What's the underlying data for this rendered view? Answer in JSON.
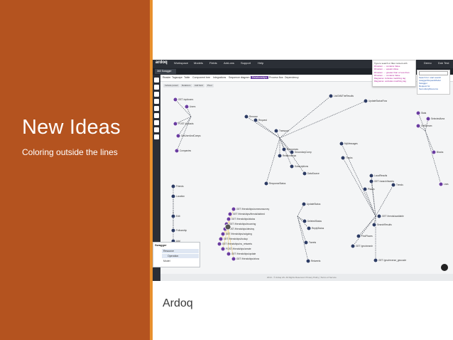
{
  "slide": {
    "title": "New Ideas",
    "subtitle": "Coloring outside the lines",
    "caption": "Ardoq"
  },
  "app": {
    "logo": "ardoq",
    "nav": [
      "Workspace",
      "Models",
      "Fields",
      "Add-ons",
      "Support",
      "Help"
    ],
    "right_menu": [
      "Demo",
      "Dok Test"
    ],
    "tab": "360 Swagger"
  },
  "views": {
    "items": [
      "Reader",
      "Tagscape",
      "Table",
      "Component tree",
      "Integrations",
      "Sequence diagram",
      "Relationships",
      "Process flow",
      "Dependency"
    ],
    "active": "Relationships"
  },
  "actions": [
    "Include parent",
    "Relations",
    "Add field",
    "Pivot"
  ],
  "tooltip": {
    "head": "Type to search or filter content with",
    "lines": [
      "#Custom ...: contains Value",
      "#Custom ...: equals Value",
      "#Custom ...: greater than or less than",
      "#Custom ...: contains Value",
      "#tagname: includes matching tag",
      "#tagname: excludes matching tag"
    ]
  },
  "search_results": [
    "Search for: start search",
    "swaggerRequestModel",
    "Swagger",
    "Request for",
    "SecondaryResource"
  ],
  "swagger_panel": {
    "title": "Swagger",
    "rows": [
      "Resource",
      "Operation",
      "Model"
    ]
  },
  "footer": "2014 - © Ardoq AS. All Rights Reserved. Privacy Policy | Terms of Service",
  "graph_labels": {
    "top_left": [
      "GET /api/users",
      "Users",
      "POST /uploads",
      "GetUserAndComps",
      "Companies"
    ],
    "top_mid": [
      "ListOfAllTheResults",
      "UpdateStatusFlow",
      "Remove",
      "Request",
      "Transport",
      "Responses",
      "SecondaryComp",
      "Relationships",
      "Subscriptions",
      "DataSource",
      "ResponseStatus"
    ],
    "left_edge": [
      "Friends",
      "Location",
      "Edit",
      "Followship",
      "Add"
    ],
    "cluster": [
      "GET /friendships/commonsurvey",
      "GET /friendships/friends/tabbed",
      "GET /friendships/status",
      "GET /friendships/incoming",
      "POST /friendships/destroy",
      "GET /friendships/outgoing",
      "GET /friendships/lookup",
      "GET /friendships/no_retweets",
      "POST /friendships/create",
      "GET /friendships/update",
      "GET /friendships/show"
    ],
    "bottom_mid": [
      "UpdateStatus",
      "DeletedStatus",
      "ReplyStatus",
      "Tweets",
      "Retweets"
    ],
    "right": [
      "MyMessages",
      "Tracks",
      "LocalResults",
      "GET /search/tweets",
      "Trends",
      "Places",
      "GET /trends/available",
      "SearchResults",
      "FindPlaces",
      "GET /geo/search",
      "GET /geo/reverse_geocode"
    ],
    "right_top": [
      "Stats",
      "SelectedArea",
      "GetStream",
      "Blocks",
      "Lists"
    ]
  },
  "colors": {
    "left_panel": "#b4531f",
    "accent_bar": "#e8902e",
    "node_purple": "#6a3ca0",
    "node_navy": "#2c3b64",
    "edge": "#444a55",
    "highlight_edge": "#f2d27a"
  }
}
